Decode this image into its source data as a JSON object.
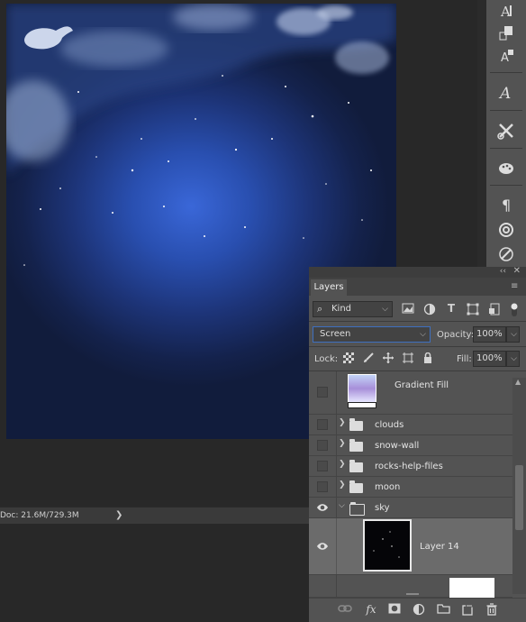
{
  "document": {
    "status_text": "Doc: 21.6M/729.3M",
    "status_arrow": "❯"
  },
  "toolbar_right": {
    "icons": [
      "character-icon",
      "paragraph-styles-icon",
      "character-styles-icon",
      "glyphs-icon",
      "tools-icon",
      "brush-presets-icon",
      "paragraph-icon",
      "libraries-icon",
      "adjustments-icon"
    ]
  },
  "layers_panel": {
    "collapse_glyph": "‹‹",
    "close_glyph": "✕",
    "tab_label": "Layers",
    "menu_glyph": "≡",
    "filter": {
      "search_glyph": "⌕",
      "kind_label": "Kind",
      "dropdown_glyph": "⌵"
    },
    "blend_mode": "Screen",
    "opacity_label": "Opacity:",
    "opacity_value": "100%",
    "lock_label": "Lock:",
    "fill_label": "Fill:",
    "fill_value": "100%",
    "layers": [
      {
        "name": "Gradient Fill",
        "visible": false,
        "type": "fill"
      },
      {
        "name": "clouds",
        "visible": false,
        "type": "group"
      },
      {
        "name": "snow-wall",
        "visible": false,
        "type": "group"
      },
      {
        "name": "rocks-help-files",
        "visible": false,
        "type": "group"
      },
      {
        "name": "moon",
        "visible": false,
        "type": "group"
      },
      {
        "name": "sky",
        "visible": true,
        "type": "group",
        "expanded": true
      },
      {
        "name": "Layer 14",
        "visible": true,
        "type": "pixel",
        "selected": true
      }
    ],
    "footer_icons": [
      "link-icon",
      "fx-icon",
      "mask-icon",
      "adjustment-icon",
      "folder-icon",
      "new-layer-icon",
      "trash-icon"
    ],
    "footer_fx": "fx"
  },
  "colors": {
    "panel_bg": "#535353",
    "selected_row": "#6b6b6b",
    "accent_blue": "#3e6fc0",
    "canvas_center": "#3a67d8"
  }
}
